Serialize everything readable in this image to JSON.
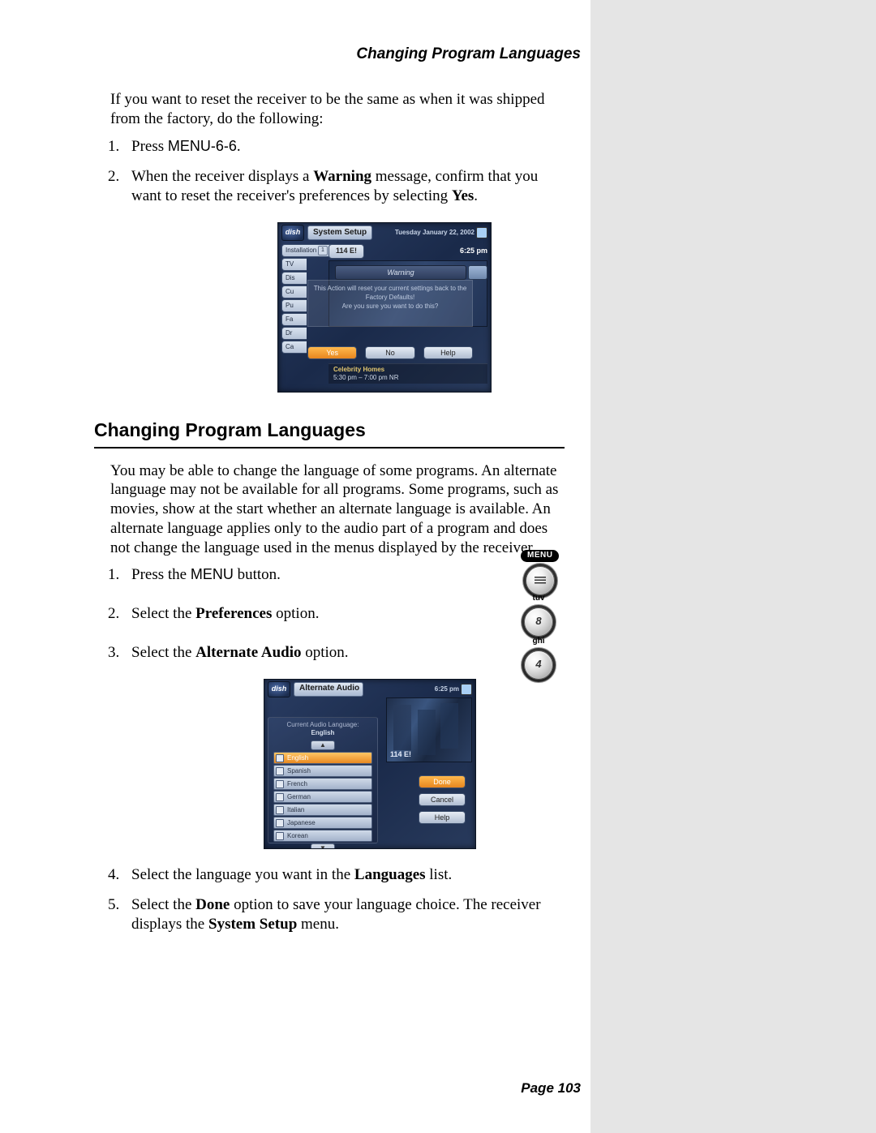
{
  "header": {
    "title": "Changing Program Languages"
  },
  "footer": {
    "page": "Page 103"
  },
  "resetIntro": "If you want to reset the receiver to be the same as when it was shipped from the factory, do the following:",
  "resetSteps": {
    "s1_pre": "Press ",
    "s1_code": "MENU-6-6",
    "s1_post": ".",
    "s2_a": "When the receiver displays a ",
    "s2_b": "Warning",
    "s2_c": " message, confirm that you want to reset the receiver's preferences by selecting ",
    "s2_d": "Yes",
    "s2_e": "."
  },
  "sectionTitle": "Changing Program Languages",
  "langIntro": "You may be able to change the language of some programs. An alternate language may not be available for all programs. Some programs, such as movies, show at the start whether an alternate language is available. An alternate language applies only to the audio part of a program and does not change the language used in the menus displayed by the receiver.",
  "langSteps": {
    "s1_pre": "Press the ",
    "s1_code": "MENU",
    "s1_post": " button.",
    "s2_pre": "Select the ",
    "s2_b": "Preferences",
    "s2_post": " option.",
    "s3_pre": "Select the ",
    "s3_b": "Alternate Audio",
    "s3_post": " option.",
    "s4_pre": "Select the language you want in the ",
    "s4_b": "Languages",
    "s4_post": " list.",
    "s5_pre": "Select the ",
    "s5_b": "Done",
    "s5_mid": " option to save your language choice. The receiver displays the ",
    "s5_b2": "System Setup",
    "s5_post": " menu."
  },
  "remote": {
    "menu_label": "MENU",
    "tuv_label": "tuv",
    "tuv_digit": "8",
    "ghi_label": "ghi",
    "ghi_digit": "4"
  },
  "shot1": {
    "logo": "dish",
    "title": "System Setup",
    "date": "Tuesday  January 22, 2002",
    "tabs": [
      "Installation",
      "TV",
      "Dis",
      "Cu",
      "Pu",
      "Fa",
      "Dr",
      "Ca"
    ],
    "tab_num": "1",
    "channel": "114 E!",
    "time": "6:25 pm",
    "warn_hdr": "Warning",
    "warn_l1": "This Action will reset your current settings back to the",
    "warn_l2": "Factory Defaults!",
    "warn_l3": "Are you sure you want to do this?",
    "btn_yes": "Yes",
    "btn_no": "No",
    "btn_help": "Help",
    "prog_title": "Celebrity Homes",
    "prog_time": "5:30 pm – 7:00 pm   NR"
  },
  "shot2": {
    "logo": "dish",
    "title": "Alternate Audio",
    "clock": "6:25 pm",
    "cur_label": "Current Audio Language:",
    "cur_lang": "English",
    "items": [
      "English",
      "Spanish",
      "French",
      "German",
      "Italian",
      "Japanese",
      "Korean"
    ],
    "channel": "114  E!",
    "btn_done": "Done",
    "btn_cancel": "Cancel",
    "btn_help": "Help"
  }
}
